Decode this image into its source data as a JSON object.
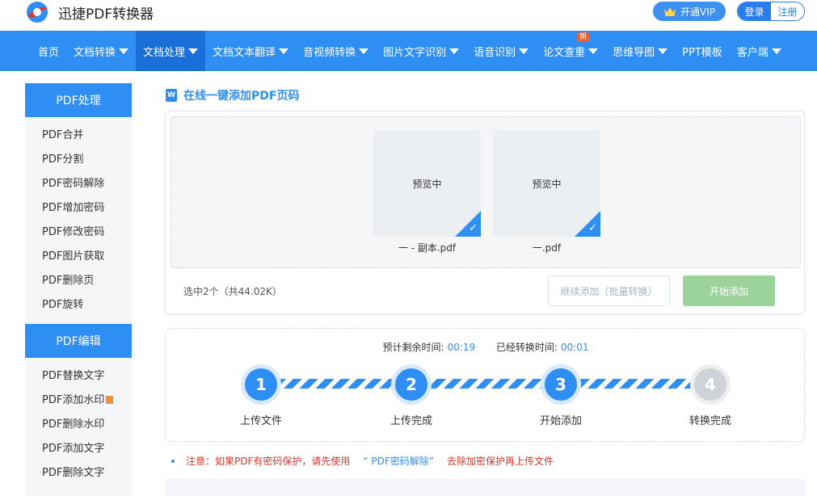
{
  "header": {
    "brand": "迅捷PDF转换器",
    "vip_label": "开通VIP",
    "login_label": "登录",
    "register_label": "注册"
  },
  "nav": {
    "items": [
      {
        "label": "首页",
        "dropdown": false
      },
      {
        "label": "文档转换",
        "dropdown": true
      },
      {
        "label": "文档处理",
        "dropdown": true,
        "active": true
      },
      {
        "label": "文档文本翻译",
        "dropdown": true
      },
      {
        "label": "音视频转换",
        "dropdown": true
      },
      {
        "label": "图片文字识别",
        "dropdown": true
      },
      {
        "label": "语音识别",
        "dropdown": true
      },
      {
        "label": "论文查重",
        "dropdown": true,
        "badge": "新"
      },
      {
        "label": "思维导图",
        "dropdown": true
      },
      {
        "label": "PPT模板",
        "dropdown": false
      },
      {
        "label": "客户端",
        "dropdown": true
      }
    ]
  },
  "sidebar": {
    "group1_title": "PDF处理",
    "group1_items": [
      "PDF合并",
      "PDF分割",
      "PDF密码解除",
      "PDF增加密码",
      "PDF修改密码",
      "PDF图片获取",
      "PDF删除页",
      "PDF旋转"
    ],
    "group2_title": "PDF编辑",
    "group2_items": [
      "PDF替换文字",
      "PDF添加水印",
      "PDF删除水印",
      "PDF添加文字",
      "PDF删除文字"
    ]
  },
  "main": {
    "section_title": "在线一键添加PDF页码",
    "doc_icon": "W",
    "files": [
      {
        "preview_text": "预览中",
        "name": "一 - 副本.pdf"
      },
      {
        "preview_text": "预览中",
        "name": "一.pdf"
      }
    ],
    "selected_info": "选中2个（共44.02K）",
    "continue_label": "继续添加（批量转换）",
    "start_label": "开始添加"
  },
  "progress": {
    "remaining_label": "预计剩余时间:",
    "remaining_value": "00:19",
    "elapsed_label": "已经转换时间:",
    "elapsed_value": "00:01",
    "steps": [
      {
        "number": "1",
        "label": "上传文件",
        "done": true
      },
      {
        "number": "2",
        "label": "上传完成",
        "done": true
      },
      {
        "number": "3",
        "label": "开始添加",
        "done": true
      },
      {
        "number": "4",
        "label": "转换完成",
        "done": false
      }
    ]
  },
  "notice": {
    "prefix": "注意：如果PDF有密码保护，请先使用",
    "link": "“ PDF密码解除”",
    "suffix": "去除加密保护再上传文件"
  },
  "colors": {
    "primary": "#2f8ef4",
    "nav_active": "#1a6ed8",
    "start_button": "#9bd39b",
    "notice": "#d9352b"
  }
}
